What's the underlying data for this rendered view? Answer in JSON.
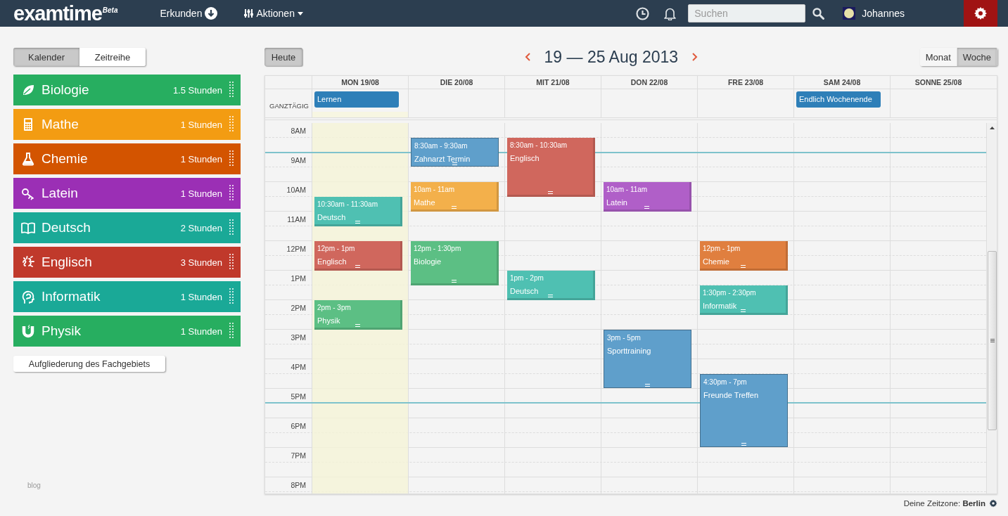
{
  "topbar": {
    "logo": "examtime",
    "logo_badge": "Beta",
    "menu": [
      {
        "label": "Erkunden"
      },
      {
        "label": "Aktionen"
      }
    ],
    "search": {
      "placeholder": "Suchen"
    },
    "user": "Johannes"
  },
  "view_tabs": [
    {
      "label": "Kalender",
      "selected": true
    },
    {
      "label": "Zeitreihe",
      "selected": false
    }
  ],
  "subjects": [
    {
      "name": "Biologie",
      "hours": "1.5 Stunden",
      "color": "#27ae60"
    },
    {
      "name": "Mathe",
      "hours": "1 Stunden",
      "color": "#f39c12"
    },
    {
      "name": "Chemie",
      "hours": "1 Stunden",
      "color": "#d35400"
    },
    {
      "name": "Latein",
      "hours": "1 Stunden",
      "color": "#9b2fb5"
    },
    {
      "name": "Deutsch",
      "hours": "2 Stunden",
      "color": "#1aa997"
    },
    {
      "name": "Englisch",
      "hours": "3 Stunden",
      "color": "#c0392b"
    },
    {
      "name": "Informatik",
      "hours": "1 Stunden",
      "color": "#1aa997"
    },
    {
      "name": "Physik",
      "hours": "1 Stunden",
      "color": "#27ae60"
    }
  ],
  "breakdown_button": "Aufgliederung des Fachgebiets",
  "blog_link": "blog",
  "calendar": {
    "today_button": "Heute",
    "title": "19 — 25 Aug 2013",
    "views": [
      {
        "label": "Monat",
        "selected": false
      },
      {
        "label": "Woche",
        "selected": true
      }
    ],
    "allday_label": "GANZTÄGIG",
    "days": [
      {
        "label": "MON 19/08",
        "today": true,
        "allday": [
          {
            "title": "Lernen",
            "color": "#2e7fb8"
          }
        ],
        "events": [
          {
            "time": "10:30am - 11:30am",
            "title": "Deutsch",
            "kind": "lesson",
            "color": "#4fc0b2"
          },
          {
            "time": "12pm - 1pm",
            "title": "Englisch",
            "kind": "lesson",
            "color": "#d0675d"
          },
          {
            "time": "2pm - 3pm",
            "title": "Physik",
            "kind": "lesson",
            "color": "#5cbf84"
          }
        ]
      },
      {
        "label": "DIE 20/08",
        "today": false,
        "events": [
          {
            "time": "8:30am - 9:30am",
            "title": "Zahnarzt Termin",
            "kind": "appointment",
            "color": "#5f9fcb"
          },
          {
            "time": "10am - 11am",
            "title": "Mathe",
            "kind": "lesson",
            "color": "#f3b04b"
          },
          {
            "time": "12pm - 1:30pm",
            "title": "Biologie",
            "kind": "lesson",
            "color": "#5cbf84"
          }
        ]
      },
      {
        "label": "MIT 21/08",
        "today": false,
        "events": [
          {
            "time": "8:30am - 10:30am",
            "title": "Englisch",
            "kind": "lesson",
            "color": "#d0675d"
          },
          {
            "time": "1pm - 2pm",
            "title": "Deutsch",
            "kind": "lesson",
            "color": "#4fc0b2"
          }
        ]
      },
      {
        "label": "DON 22/08",
        "today": false,
        "events": [
          {
            "time": "10am - 11am",
            "title": "Latein",
            "kind": "lesson",
            "color": "#b05fc8"
          },
          {
            "time": "3pm - 5pm",
            "title": "Sporttraining",
            "kind": "appointment",
            "color": "#5f9fcb"
          }
        ]
      },
      {
        "label": "FRE 23/08",
        "today": false,
        "events": [
          {
            "time": "12pm - 1pm",
            "title": "Chemie",
            "kind": "lesson",
            "color": "#e07f3f"
          },
          {
            "time": "1:30pm - 2:30pm",
            "title": "Informatik",
            "kind": "lesson",
            "color": "#4fc0b2"
          },
          {
            "time": "4:30pm - 7pm",
            "title": "Freunde Treffen",
            "kind": "appointment",
            "color": "#5f9fcb"
          }
        ]
      },
      {
        "label": "SAM 24/08",
        "today": false,
        "allday": [
          {
            "title": "Endlich Wochenende",
            "color": "#2e7fb8"
          }
        ]
      },
      {
        "label": "SONNE 25/08",
        "today": false
      }
    ],
    "hours": [
      "8AM",
      "9AM",
      "10AM",
      "11AM",
      "12PM",
      "1PM",
      "2PM",
      "3PM",
      "4PM",
      "5PM",
      "6PM",
      "7PM",
      "8PM"
    ],
    "timezone": "Deine Zeitzone: **Berlin**"
  }
}
